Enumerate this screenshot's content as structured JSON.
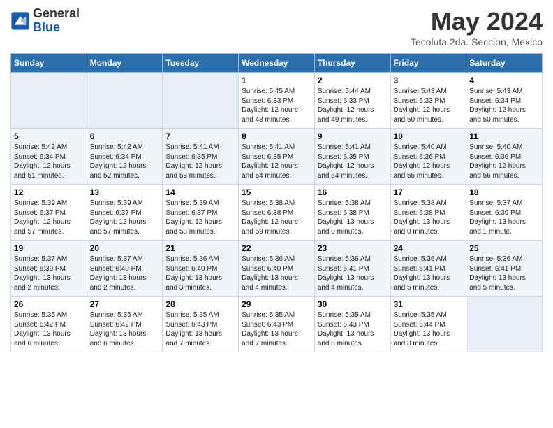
{
  "header": {
    "logo_general": "General",
    "logo_blue": "Blue",
    "month_title": "May 2024",
    "subtitle": "Tecoluta 2da. Seccion, Mexico"
  },
  "weekdays": [
    "Sunday",
    "Monday",
    "Tuesday",
    "Wednesday",
    "Thursday",
    "Friday",
    "Saturday"
  ],
  "weeks": [
    [
      {
        "day": "",
        "content": ""
      },
      {
        "day": "",
        "content": ""
      },
      {
        "day": "",
        "content": ""
      },
      {
        "day": "1",
        "content": "Sunrise: 5:45 AM\nSunset: 6:33 PM\nDaylight: 12 hours\nand 48 minutes."
      },
      {
        "day": "2",
        "content": "Sunrise: 5:44 AM\nSunset: 6:33 PM\nDaylight: 12 hours\nand 49 minutes."
      },
      {
        "day": "3",
        "content": "Sunrise: 5:43 AM\nSunset: 6:33 PM\nDaylight: 12 hours\nand 50 minutes."
      },
      {
        "day": "4",
        "content": "Sunrise: 5:43 AM\nSunset: 6:34 PM\nDaylight: 12 hours\nand 50 minutes."
      }
    ],
    [
      {
        "day": "5",
        "content": "Sunrise: 5:42 AM\nSunset: 6:34 PM\nDaylight: 12 hours\nand 51 minutes."
      },
      {
        "day": "6",
        "content": "Sunrise: 5:42 AM\nSunset: 6:34 PM\nDaylight: 12 hours\nand 52 minutes."
      },
      {
        "day": "7",
        "content": "Sunrise: 5:41 AM\nSunset: 6:35 PM\nDaylight: 12 hours\nand 53 minutes."
      },
      {
        "day": "8",
        "content": "Sunrise: 5:41 AM\nSunset: 6:35 PM\nDaylight: 12 hours\nand 54 minutes."
      },
      {
        "day": "9",
        "content": "Sunrise: 5:41 AM\nSunset: 6:35 PM\nDaylight: 12 hours\nand 54 minutes."
      },
      {
        "day": "10",
        "content": "Sunrise: 5:40 AM\nSunset: 6:36 PM\nDaylight: 12 hours\nand 55 minutes."
      },
      {
        "day": "11",
        "content": "Sunrise: 5:40 AM\nSunset: 6:36 PM\nDaylight: 12 hours\nand 56 minutes."
      }
    ],
    [
      {
        "day": "12",
        "content": "Sunrise: 5:39 AM\nSunset: 6:37 PM\nDaylight: 12 hours\nand 57 minutes."
      },
      {
        "day": "13",
        "content": "Sunrise: 5:39 AM\nSunset: 6:37 PM\nDaylight: 12 hours\nand 57 minutes."
      },
      {
        "day": "14",
        "content": "Sunrise: 5:39 AM\nSunset: 6:37 PM\nDaylight: 12 hours\nand 58 minutes."
      },
      {
        "day": "15",
        "content": "Sunrise: 5:38 AM\nSunset: 6:38 PM\nDaylight: 12 hours\nand 59 minutes."
      },
      {
        "day": "16",
        "content": "Sunrise: 5:38 AM\nSunset: 6:38 PM\nDaylight: 13 hours\nand 0 minutes."
      },
      {
        "day": "17",
        "content": "Sunrise: 5:38 AM\nSunset: 6:38 PM\nDaylight: 13 hours\nand 0 minutes."
      },
      {
        "day": "18",
        "content": "Sunrise: 5:37 AM\nSunset: 6:39 PM\nDaylight: 13 hours\nand 1 minute."
      }
    ],
    [
      {
        "day": "19",
        "content": "Sunrise: 5:37 AM\nSunset: 6:39 PM\nDaylight: 13 hours\nand 2 minutes."
      },
      {
        "day": "20",
        "content": "Sunrise: 5:37 AM\nSunset: 6:40 PM\nDaylight: 13 hours\nand 2 minutes."
      },
      {
        "day": "21",
        "content": "Sunrise: 5:36 AM\nSunset: 6:40 PM\nDaylight: 13 hours\nand 3 minutes."
      },
      {
        "day": "22",
        "content": "Sunrise: 5:36 AM\nSunset: 6:40 PM\nDaylight: 13 hours\nand 4 minutes."
      },
      {
        "day": "23",
        "content": "Sunrise: 5:36 AM\nSunset: 6:41 PM\nDaylight: 13 hours\nand 4 minutes."
      },
      {
        "day": "24",
        "content": "Sunrise: 5:36 AM\nSunset: 6:41 PM\nDaylight: 13 hours\nand 5 minutes."
      },
      {
        "day": "25",
        "content": "Sunrise: 5:36 AM\nSunset: 6:41 PM\nDaylight: 13 hours\nand 5 minutes."
      }
    ],
    [
      {
        "day": "26",
        "content": "Sunrise: 5:35 AM\nSunset: 6:42 PM\nDaylight: 13 hours\nand 6 minutes."
      },
      {
        "day": "27",
        "content": "Sunrise: 5:35 AM\nSunset: 6:42 PM\nDaylight: 13 hours\nand 6 minutes."
      },
      {
        "day": "28",
        "content": "Sunrise: 5:35 AM\nSunset: 6:43 PM\nDaylight: 13 hours\nand 7 minutes."
      },
      {
        "day": "29",
        "content": "Sunrise: 5:35 AM\nSunset: 6:43 PM\nDaylight: 13 hours\nand 7 minutes."
      },
      {
        "day": "30",
        "content": "Sunrise: 5:35 AM\nSunset: 6:43 PM\nDaylight: 13 hours\nand 8 minutes."
      },
      {
        "day": "31",
        "content": "Sunrise: 5:35 AM\nSunset: 6:44 PM\nDaylight: 13 hours\nand 8 minutes."
      },
      {
        "day": "",
        "content": ""
      }
    ]
  ]
}
